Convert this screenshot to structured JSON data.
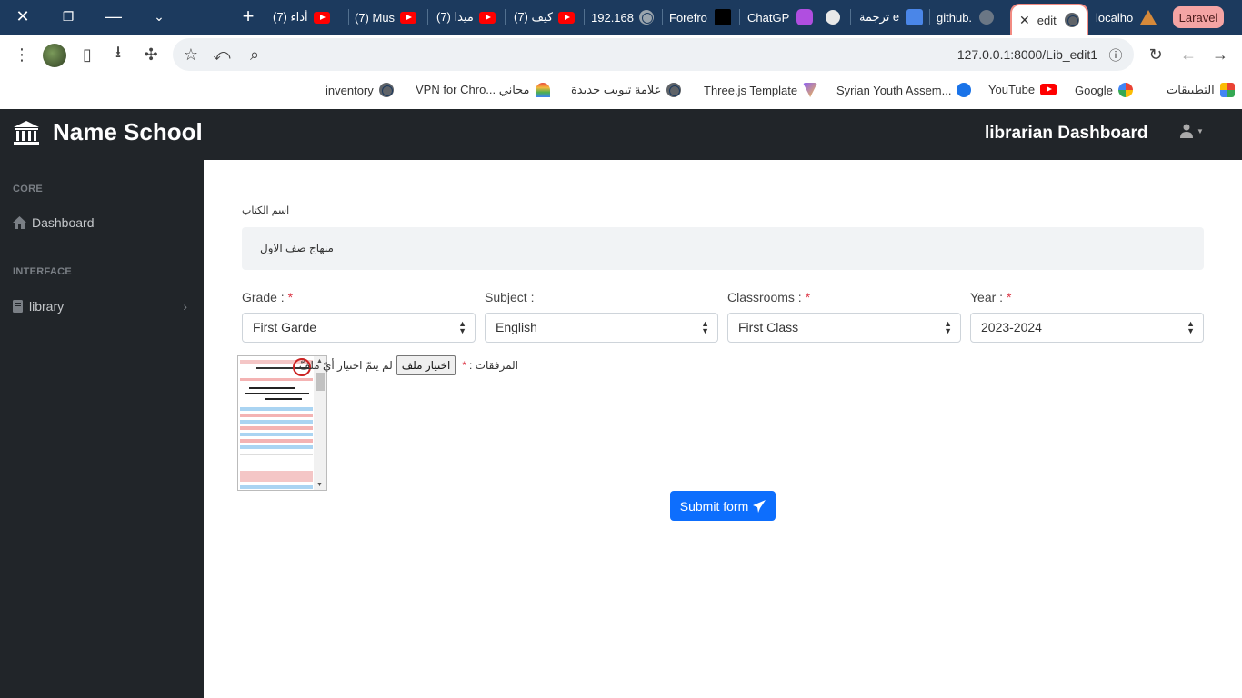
{
  "browser": {
    "tabs": [
      {
        "title": "(7) أداء",
        "icon": "youtube-icon"
      },
      {
        "title": "(7) Mus",
        "icon": "youtube-icon"
      },
      {
        "title": "(7) ميدا",
        "icon": "youtube-icon"
      },
      {
        "title": "(7) كيف",
        "icon": "youtube-icon"
      },
      {
        "title": "192.168",
        "icon": "globe-icon"
      },
      {
        "title": "Forefro",
        "icon": "forefront-icon"
      },
      {
        "title": "ChatGP",
        "icon": "chatbot-icon"
      },
      {
        "title": "",
        "icon": "circle-icon"
      },
      {
        "title": "ترجمة e",
        "icon": "translate-icon"
      },
      {
        "title": "github.",
        "icon": "github-icon"
      },
      {
        "title": "edit",
        "icon": "globe-icon",
        "active": true
      },
      {
        "title": "localho",
        "icon": "laravel-icon"
      }
    ],
    "group_chip": "Laravel",
    "url": "127.0.0.1:8000/Lib_edit1",
    "bookmarks": [
      {
        "label": "التطبيقات",
        "icon": "apps-icon"
      },
      {
        "label": "Google",
        "icon": "google-icon"
      },
      {
        "label": "YouTube",
        "icon": "youtube-icon"
      },
      {
        "label": "Syrian Youth Assem...",
        "icon": "c-icon"
      },
      {
        "label": "Three.js Template",
        "icon": "vite-icon"
      },
      {
        "label": "علامة تبويب جديدة",
        "icon": "globe-icon"
      },
      {
        "label": "VPN for Chro... مجاني",
        "icon": "vpn-icon"
      },
      {
        "label": "inventory",
        "icon": "globe-icon"
      }
    ]
  },
  "app": {
    "brand": "Name School",
    "dashboard_title": "librarian Dashboard",
    "sidebar": {
      "core_heading": "CORE",
      "dashboard_label": "Dashboard",
      "interface_heading": "INTERFACE",
      "library_label": "library"
    },
    "form": {
      "book_name_label": "اسم الكتاب",
      "book_name_value": "منهاج صف الاول",
      "grade_label": "Grade :",
      "grade_value": "First Garde",
      "subject_label": "Subject :",
      "subject_value": "English",
      "classrooms_label": "Classrooms :",
      "classrooms_value": "First Class",
      "year_label": "Year :",
      "year_value": "2023-2024",
      "required_mark": "*",
      "attachments_label": "المرفقات :",
      "choose_file_button": "اختيار ملف",
      "no_file_text": "لم يتمّ اختيار أيّ ملفّ",
      "submit_label": "Submit form"
    }
  },
  "colors": {
    "tabstrip": "#1c3a5e",
    "navbar": "#212529",
    "primary": "#0d6efd",
    "required": "#dc3545"
  }
}
